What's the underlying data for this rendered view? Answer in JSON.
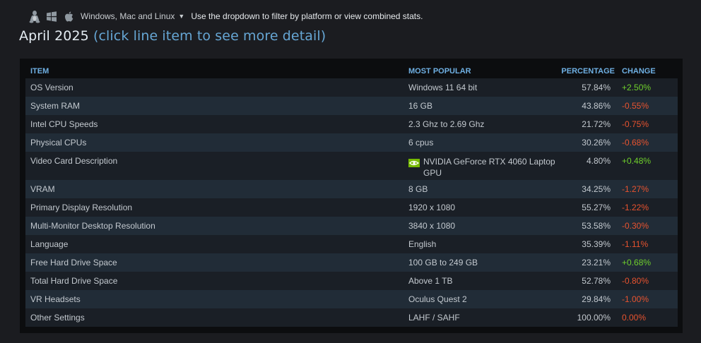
{
  "platform_bar": {
    "icons": [
      "linux-tux-icon",
      "windows-icon",
      "apple-icon"
    ],
    "selected": "Windows, Mac and Linux",
    "hint": "Use the dropdown to filter by platform or view combined stats."
  },
  "heading": {
    "month": "April 2025",
    "subtitle": "(click line item to see more detail)"
  },
  "table": {
    "headers": {
      "item": "ITEM",
      "popular": "MOST POPULAR",
      "percentage": "PERCENTAGE",
      "change": "CHANGE"
    },
    "rows": [
      {
        "item": "OS Version",
        "popular": "Windows 11 64 bit",
        "percentage": "57.84%",
        "change": "+2.50%",
        "trend": "pos"
      },
      {
        "item": "System RAM",
        "popular": "16 GB",
        "percentage": "43.86%",
        "change": "-0.55%",
        "trend": "neg"
      },
      {
        "item": "Intel CPU Speeds",
        "popular": "2.3 Ghz to 2.69 Ghz",
        "percentage": "21.72%",
        "change": "-0.75%",
        "trend": "neg"
      },
      {
        "item": "Physical CPUs",
        "popular": "6 cpus",
        "percentage": "30.26%",
        "change": "-0.68%",
        "trend": "neg"
      },
      {
        "item": "Video Card Description",
        "popular": "NVIDIA GeForce RTX 4060 Laptop GPU",
        "percentage": "4.80%",
        "change": "+0.48%",
        "trend": "pos",
        "icon": "nvidia-icon"
      },
      {
        "item": "VRAM",
        "popular": "8 GB",
        "percentage": "34.25%",
        "change": "-1.27%",
        "trend": "neg"
      },
      {
        "item": "Primary Display Resolution",
        "popular": "1920 x 1080",
        "percentage": "55.27%",
        "change": "-1.22%",
        "trend": "neg"
      },
      {
        "item": "Multi-Monitor Desktop Resolution",
        "popular": "3840 x 1080",
        "percentage": "53.58%",
        "change": "-0.30%",
        "trend": "neg"
      },
      {
        "item": "Language",
        "popular": "English",
        "percentage": "35.39%",
        "change": "-1.11%",
        "trend": "neg"
      },
      {
        "item": "Free Hard Drive Space",
        "popular": "100 GB to 249 GB",
        "percentage": "23.21%",
        "change": "+0.68%",
        "trend": "pos"
      },
      {
        "item": "Total Hard Drive Space",
        "popular": "Above 1 TB",
        "percentage": "52.78%",
        "change": "-0.80%",
        "trend": "neg"
      },
      {
        "item": "VR Headsets",
        "popular": "Oculus Quest 2",
        "percentage": "29.84%",
        "change": "-1.00%",
        "trend": "neg"
      },
      {
        "item": "Other Settings",
        "popular": "LAHF / SAHF",
        "percentage": "100.00%",
        "change": "0.00%",
        "trend": "neutral"
      }
    ]
  },
  "colors": {
    "background": "#1b1c20",
    "panel": "#0c0d0f",
    "row_odd": "#1a1f26",
    "row_even": "#212c37",
    "header_blue": "#6fb0e3",
    "link_blue": "#66a6d4",
    "positive": "#6fcf2c",
    "negative": "#e8532f"
  }
}
